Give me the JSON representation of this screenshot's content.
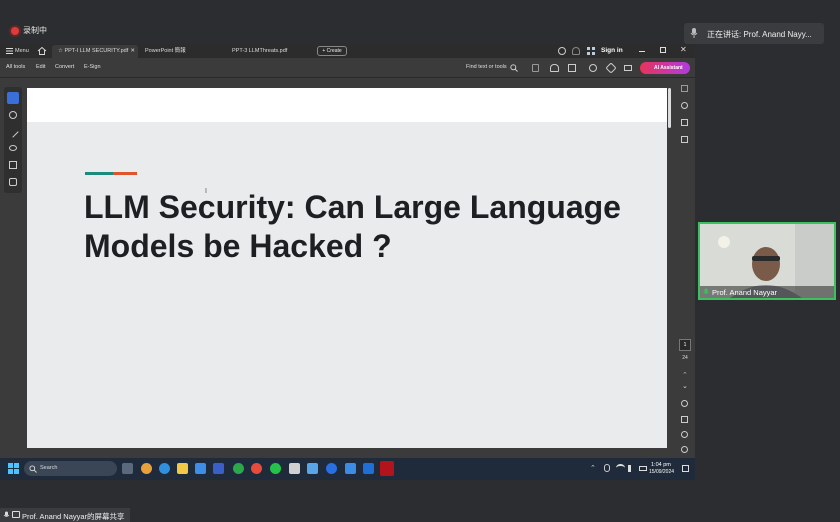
{
  "meeting": {
    "recording_label": "录制中",
    "speaker_label": "正在讲话:  Prof. Anand Nayy...",
    "video_name": "Prof. Anand Nayyar",
    "share_label": "Prof. Anand Nayyar的屏幕共享"
  },
  "acrobat": {
    "menu_label": "Menu",
    "tabs": [
      {
        "label": "PPT-I LLM SECURITY.pdf",
        "active": true
      },
      {
        "label": "PowerPoint 簡報",
        "active": false
      },
      {
        "label": "PPT-3 LLMThreats.pdf",
        "active": false
      }
    ],
    "create_label": "Create",
    "sign_in_label": "Sign in",
    "menu_items": [
      "All tools",
      "Edit",
      "Convert",
      "E-Sign"
    ],
    "find_label": "Find text or tools",
    "ai_label": "AI Assistant",
    "page_current": "1",
    "page_total": "24"
  },
  "slide": {
    "title": "LLM Security: Can Large Language Models be Hacked ?",
    "accent_colors": [
      "#1d8a7e",
      "#e0542d"
    ]
  },
  "taskbar": {
    "search_label": "Search",
    "time": "1:04 pm",
    "date": "15/09/2024"
  },
  "icons": [
    "record-dot-icon",
    "mic-icon",
    "home-icon",
    "star-icon",
    "close-icon",
    "help-icon",
    "bell-icon",
    "apps-icon",
    "minimize-icon",
    "maximize-icon",
    "search-icon",
    "windows-icon",
    "pdf-icon",
    "wifi-icon",
    "volume-icon",
    "battery-icon"
  ]
}
